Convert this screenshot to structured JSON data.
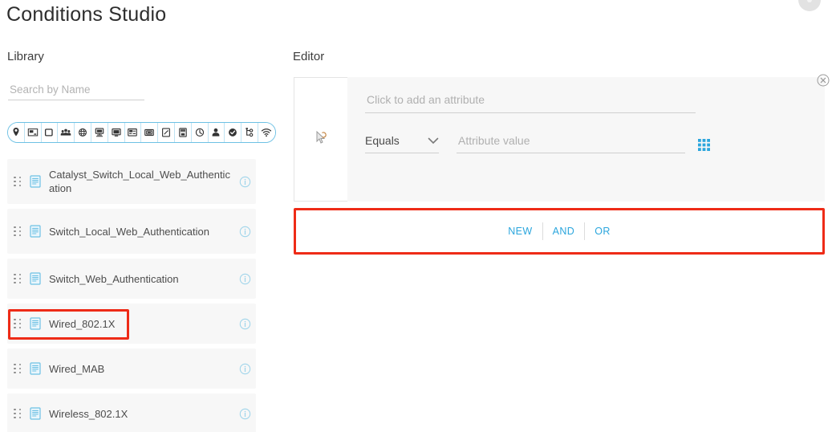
{
  "page": {
    "title": "Conditions Studio"
  },
  "library": {
    "heading": "Library",
    "search": {
      "placeholder": "Search by Name",
      "value": ""
    },
    "filter_icons": [
      {
        "name": "location-pin-icon"
      },
      {
        "name": "network-device-icon"
      },
      {
        "name": "square-outline-icon"
      },
      {
        "name": "identity-group-icon"
      },
      {
        "name": "globe-icon"
      },
      {
        "name": "network-access-icon"
      },
      {
        "name": "desktop-device-icon"
      },
      {
        "name": "port-icon"
      },
      {
        "name": "radius-icon"
      },
      {
        "name": "posture-icon"
      },
      {
        "name": "server-icon"
      },
      {
        "name": "clock-icon"
      },
      {
        "name": "user-icon"
      },
      {
        "name": "check-circle-icon"
      },
      {
        "name": "topology-icon"
      },
      {
        "name": "wifi-icon"
      }
    ],
    "items": [
      {
        "label": "Catalyst_Switch_Local_Web_Authentication",
        "highlighted": false
      },
      {
        "label": "Switch_Local_Web_Authentication",
        "highlighted": false
      },
      {
        "label": "Switch_Web_Authentication",
        "highlighted": false
      },
      {
        "label": "Wired_802.1X",
        "highlighted": true
      },
      {
        "label": "Wired_MAB",
        "highlighted": false
      },
      {
        "label": "Wireless_802.1X",
        "highlighted": false
      }
    ],
    "row_icon_name": "condition-document-icon",
    "row_info_icon_name": "info-icon",
    "row_drag_icon_name": "drag-handle-icon"
  },
  "editor": {
    "heading": "Editor",
    "gutter_icon_name": "drop-target-cursor-icon",
    "attribute": {
      "placeholder": "Click to add an attribute",
      "value": ""
    },
    "operator": {
      "value": "Equals",
      "chevron_icon_name": "chevron-down-icon"
    },
    "attribute_value": {
      "placeholder": "Attribute value",
      "value": ""
    },
    "value_picker_icon_name": "grid-picker-icon",
    "close_icon_name": "close-circle-icon",
    "logic": {
      "new_label": "NEW",
      "and_label": "AND",
      "or_label": "OR"
    }
  },
  "colors": {
    "accent_blue": "#2ba6dd",
    "icon_blue": "#6ec1e4",
    "highlight_red": "#ee2b17",
    "panel_grey": "#f7f7f7",
    "text_grey": "#4d4d4d"
  }
}
